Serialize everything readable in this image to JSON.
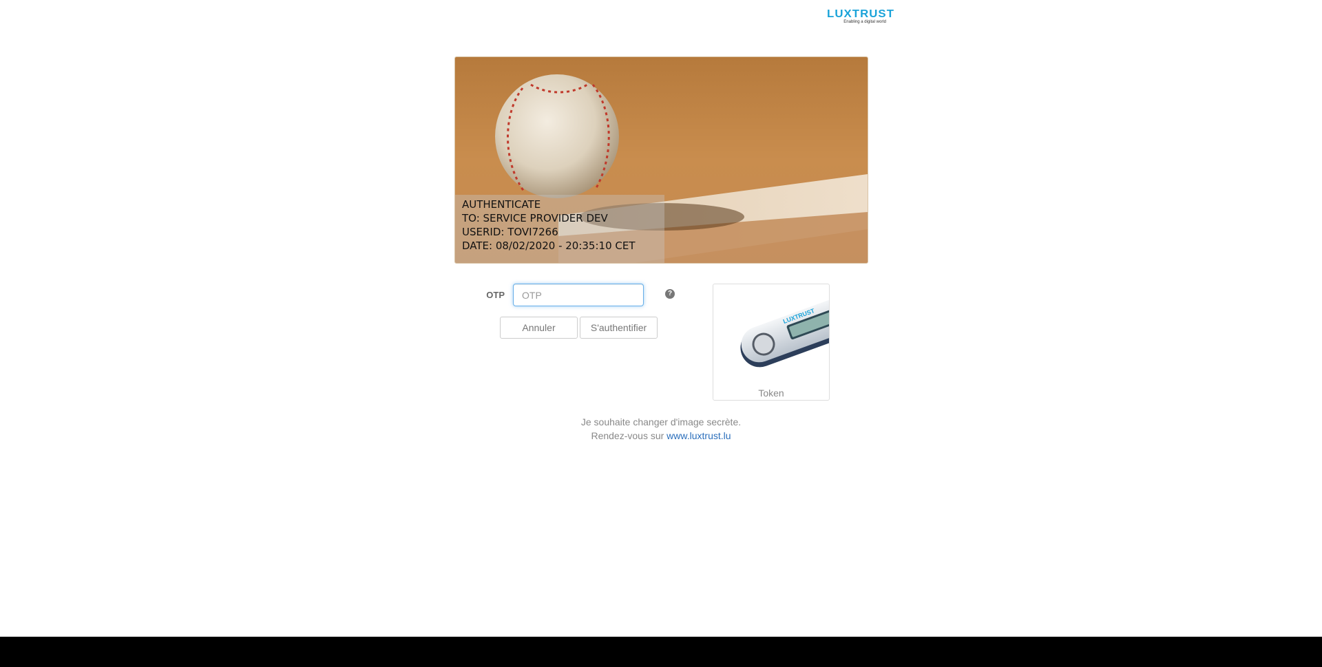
{
  "header": {
    "logo_text": "LUXTRUST",
    "logo_tagline": "Enabling a digital world",
    "brand_color": "#1aa3d9"
  },
  "secret_image": {
    "subject": "baseball",
    "challenge_lines": [
      "AUTHENTICATE",
      "TO: SERVICE PROVIDER DEV",
      "USERID: TOVI7266",
      "DATE: 08/02/2020 - 20:35:10 CET"
    ]
  },
  "form": {
    "otp_label": "OTP",
    "otp_placeholder": "OTP",
    "otp_value": "",
    "help_icon": "question-circle-icon",
    "cancel_label": "Annuler",
    "submit_label": "S'authentifier"
  },
  "token_card": {
    "label": "Token",
    "device_brand": "LUXTRUST"
  },
  "footer": {
    "line1": "Je souhaite changer d'image secrète.",
    "line2_prefix": "Rendez-vous sur ",
    "link_text": "www.luxtrust.lu",
    "link_color": "#2a6ebb"
  }
}
